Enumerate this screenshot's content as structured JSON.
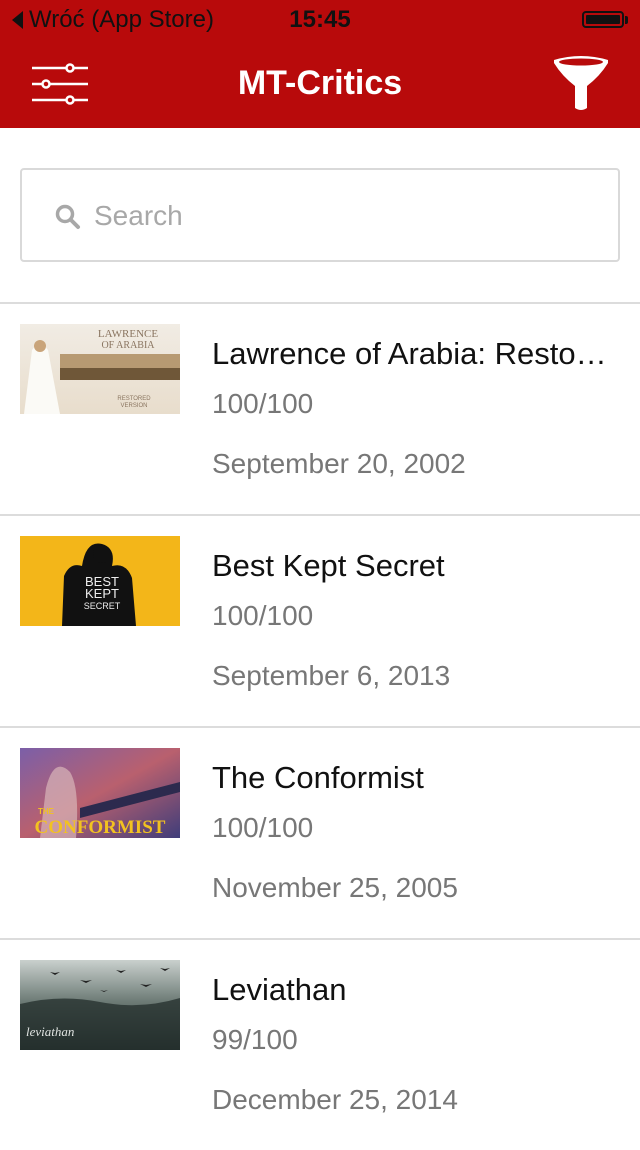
{
  "status_bar": {
    "back_label": "Wróć (App Store)",
    "time": "15:45"
  },
  "header": {
    "title": "MT-Critics",
    "background": "#b80a0b",
    "left_icon": "settings-sliders-icon",
    "right_icon": "filter-funnel-icon"
  },
  "search": {
    "placeholder": "Search",
    "value": ""
  },
  "movies": [
    {
      "title": "Lawrence of Arabia: Restored Version",
      "score": "100/100",
      "date": "September 20, 2002",
      "poster_text": [
        "LAWRENCE",
        "OF ARABIA",
        "RESTORED",
        "VERSION"
      ]
    },
    {
      "title": "Best Kept Secret",
      "score": "100/100",
      "date": "September 6, 2013",
      "poster_text": [
        "BEST",
        "KEPT",
        "SECRET"
      ]
    },
    {
      "title": "The Conformist",
      "score": "100/100",
      "date": "November 25, 2005",
      "poster_text": [
        "THE",
        "CONFORMIST"
      ]
    },
    {
      "title": "Leviathan",
      "score": "99/100",
      "date": "December 25, 2014",
      "poster_text": [
        "leviathan"
      ]
    }
  ]
}
